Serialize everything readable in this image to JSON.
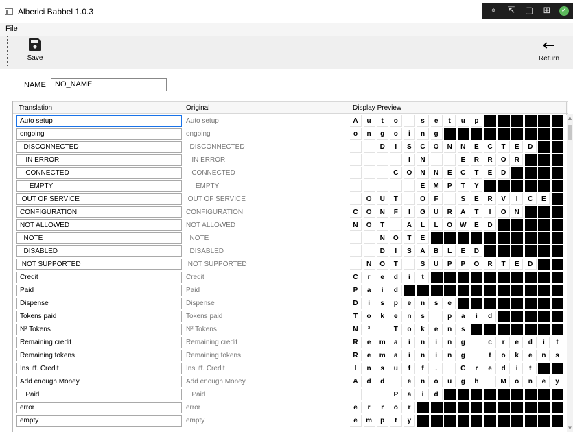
{
  "window": {
    "title": "Alberici Babbel 1.0.3"
  },
  "menu": {
    "file": "File"
  },
  "toolbar": {
    "save_label": "Save",
    "return_label": "Return"
  },
  "name_field": {
    "label": "NAME",
    "value": "NO_NAME"
  },
  "table": {
    "headers": {
      "translation": "Translation",
      "original": "Original",
      "preview": "Display Preview"
    },
    "rows": [
      {
        "translation": "Auto setup",
        "original": "Auto setup",
        "preview": "Auto setup",
        "focused": true
      },
      {
        "translation": "ongoing",
        "original": "ongoing",
        "preview": "ongoing"
      },
      {
        "translation": "  DISCONNECTED",
        "original": "  DISCONNECTED",
        "preview": "  DISCONNECTED"
      },
      {
        "translation": "   IN ERROR",
        "original": "   IN ERROR",
        "preview": "    IN  ERROR"
      },
      {
        "translation": "   CONNECTED",
        "original": "   CONNECTED",
        "preview": "   CONNECTED"
      },
      {
        "translation": "     EMPTY",
        "original": "     EMPTY",
        "preview": "     EMPTY"
      },
      {
        "translation": " OUT OF SERVICE",
        "original": " OUT OF SERVICE",
        "preview": " OUT OF SERVICE"
      },
      {
        "translation": "CONFIGURATION",
        "original": "CONFIGURATION",
        "preview": "CONFIGURATION"
      },
      {
        "translation": "NOT ALLOWED",
        "original": "NOT ALLOWED",
        "preview": "NOT ALLOWED"
      },
      {
        "translation": "  NOTE",
        "original": "  NOTE",
        "preview": "  NOTE"
      },
      {
        "translation": "  DISABLED",
        "original": "  DISABLED",
        "preview": "  DISABLED"
      },
      {
        "translation": " NOT SUPPORTED",
        "original": " NOT SUPPORTED",
        "preview": " NOT SUPPORTED"
      },
      {
        "translation": "Credit",
        "original": "Credit",
        "preview": "Credit"
      },
      {
        "translation": "Paid",
        "original": "Paid",
        "preview": "Paid"
      },
      {
        "translation": "Dispense",
        "original": "Dispense",
        "preview": "Dispense"
      },
      {
        "translation": "Tokens paid",
        "original": "Tokens paid",
        "preview": "Tokens paid"
      },
      {
        "translation": "N² Tokens",
        "original": "N² Tokens",
        "preview": "N² Tokens"
      },
      {
        "translation": "Remaining credit",
        "original": "Remaining credit",
        "preview": "Remaining credit"
      },
      {
        "translation": "Remaining tokens",
        "original": "Remaining tokens",
        "preview": "Remaining tokens"
      },
      {
        "translation": "Insuff. Credit",
        "original": "Insuff. Credit",
        "preview": "Insuff. Credit"
      },
      {
        "translation": "Add enough Money",
        "original": "Add enough Money",
        "preview": "Add enough Money"
      },
      {
        "translation": "   Paid",
        "original": "   Paid",
        "preview": "   Paid"
      },
      {
        "translation": "error",
        "original": "error",
        "preview": "error"
      },
      {
        "translation": "empty",
        "original": "empty",
        "preview": "empty"
      }
    ]
  },
  "display": {
    "columns": 16
  },
  "colors": {
    "accent": "#1a73e8",
    "preview_fill": "#000000",
    "tray_background": "#1f1f1f",
    "status_ok": "#5cb85c"
  },
  "icons": [
    "app-window-icon",
    "save-floppy-icon",
    "return-arrow-icon",
    "scroll-up-icon",
    "scroll-down-icon",
    "check-circle-icon"
  ]
}
